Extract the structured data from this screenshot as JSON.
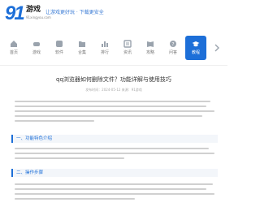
{
  "site": {
    "logo_number": "91",
    "logo_text": "游戏",
    "logo_subtext": "91xingyou.com",
    "slogan": "让游戏更好玩 · 下载更安全"
  },
  "nav": {
    "items": [
      {
        "label": "首页",
        "icon": "home-icon"
      },
      {
        "label": "游戏",
        "icon": "gamepad-icon"
      },
      {
        "label": "软件",
        "icon": "app-icon"
      },
      {
        "label": "合集",
        "icon": "folder-icon"
      },
      {
        "label": "排行",
        "icon": "chart-icon"
      },
      {
        "label": "资讯",
        "icon": "news-icon"
      },
      {
        "label": "攻略",
        "icon": "book-icon"
      },
      {
        "label": "问答",
        "icon": "question-icon"
      },
      {
        "label": "教程",
        "icon": "graduation-cap-icon"
      }
    ],
    "active_index": 8,
    "more_icon": "arrow-right-icon"
  },
  "article": {
    "title": "qq浏览器如何删除文件？功能详解与使用技巧",
    "meta": "发布时间：2024-05-12  来源：91游戏"
  },
  "sections": [
    {
      "heading": "一、功能特色介绍"
    },
    {
      "heading": "二、操作步骤"
    }
  ],
  "colors": {
    "accent": "#1d6fd8",
    "text": "#333333",
    "muted": "#aaaaaa",
    "section_bg": "#f3f6fa"
  }
}
